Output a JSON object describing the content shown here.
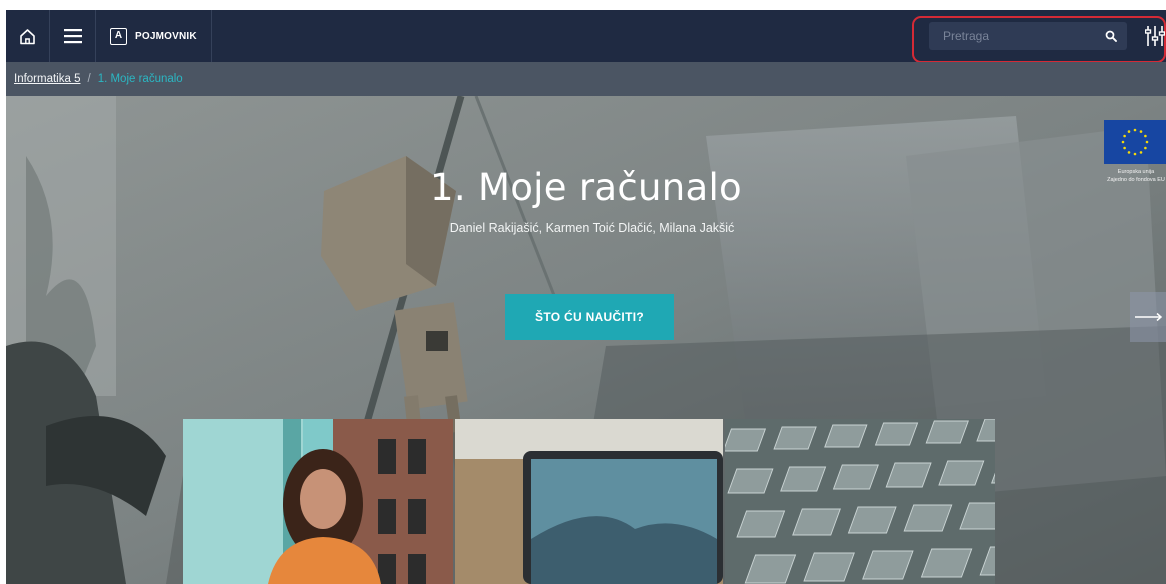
{
  "header": {
    "glossary_label": "POJMOVNIK",
    "glossary_badge": "A",
    "search_placeholder": "Pretraga",
    "icons": [
      "home-icon",
      "menu-icon",
      "search-icon",
      "filters-icon"
    ]
  },
  "breadcrumb": {
    "parent": "Informatika 5",
    "separator": "/",
    "current": "1. Moje računalo"
  },
  "hero": {
    "title": "1. Moje računalo",
    "authors": "Daniel Rakijašić, Karmen Toić Dlačić, Milana Jakšić",
    "cta_label": "ŠTO ĆU NAUČITI?"
  },
  "eu": {
    "line1": "Europska unija",
    "line2": "Zajedno do fondova EU"
  },
  "colors": {
    "nav_bg": "#1f2a42",
    "breadcrumb_bg": "#4b5563",
    "accent": "#1fa8b4",
    "highlight": "#d42a36"
  },
  "cards": [
    {
      "subject": "woman-photo"
    },
    {
      "subject": "laptop-photo"
    },
    {
      "subject": "keyboard-keys-photo"
    }
  ]
}
